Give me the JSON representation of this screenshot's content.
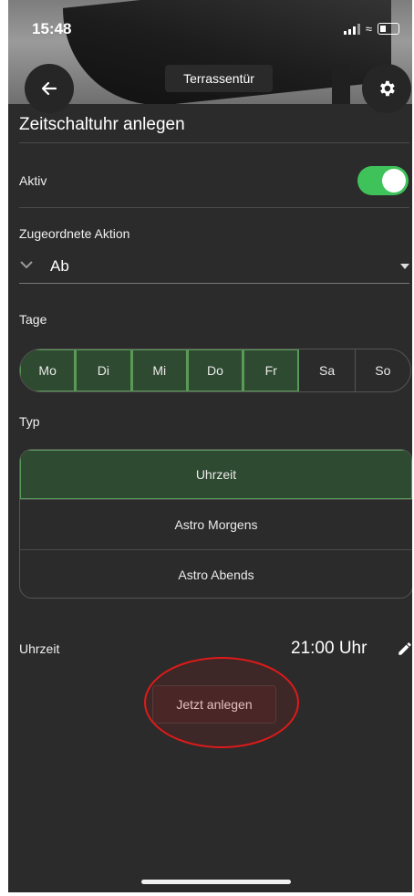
{
  "status": {
    "time": "15:48"
  },
  "header": {
    "title": "Terrassentür"
  },
  "page": {
    "title": "Zeitschaltuhr anlegen"
  },
  "active": {
    "label": "Aktiv",
    "on": true
  },
  "action": {
    "label": "Zugeordnete Aktion",
    "value": "Ab"
  },
  "days": {
    "label": "Tage",
    "items": [
      {
        "label": "Mo",
        "selected": true
      },
      {
        "label": "Di",
        "selected": true
      },
      {
        "label": "Mi",
        "selected": true
      },
      {
        "label": "Do",
        "selected": true
      },
      {
        "label": "Fr",
        "selected": true
      },
      {
        "label": "Sa",
        "selected": false
      },
      {
        "label": "So",
        "selected": false
      }
    ]
  },
  "type": {
    "label": "Typ",
    "options": [
      "Uhrzeit",
      "Astro Morgens",
      "Astro Abends"
    ],
    "selected": "Uhrzeit"
  },
  "time": {
    "label": "Uhrzeit",
    "value": "21:00 Uhr"
  },
  "create": {
    "label": "Jetzt anlegen"
  },
  "colors": {
    "accent": "#3fc25a",
    "selected_bg": "#2e4a30",
    "annotation": "#e01a1a"
  }
}
